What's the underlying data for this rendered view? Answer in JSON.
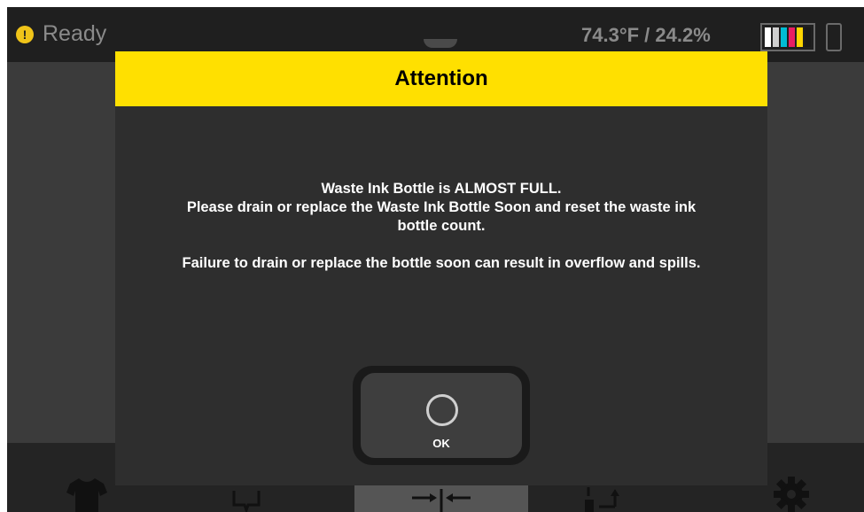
{
  "status": {
    "text": "Ready",
    "icon": "warning-icon",
    "icon_glyph": "!",
    "environment": "74.3°F / 24.2%",
    "ink_colors": [
      "#ffffff",
      "#cfcfcf",
      "#00bcd4",
      "#e91e63",
      "#ffd600",
      "#1a1a1a"
    ]
  },
  "dialog": {
    "title": "Attention",
    "line1": "Waste Ink Bottle is ALMOST FULL.",
    "line2": "Please drain or replace the Waste Ink Bottle Soon and reset the waste ink",
    "line3": "bottle count.",
    "line4": "Failure to drain or replace the bottle soon can result in overflow and spills.",
    "ok_label": "OK"
  },
  "nav": {
    "items": [
      "tshirt-icon",
      "platen-icon",
      "align-icon",
      "transfer-icon",
      "gear-icon"
    ],
    "active_index": 2
  },
  "colors": {
    "header": "#ffe000",
    "background": "#3b3b3b",
    "dialog": "#2e2e2e",
    "warning": "#f0c419"
  }
}
